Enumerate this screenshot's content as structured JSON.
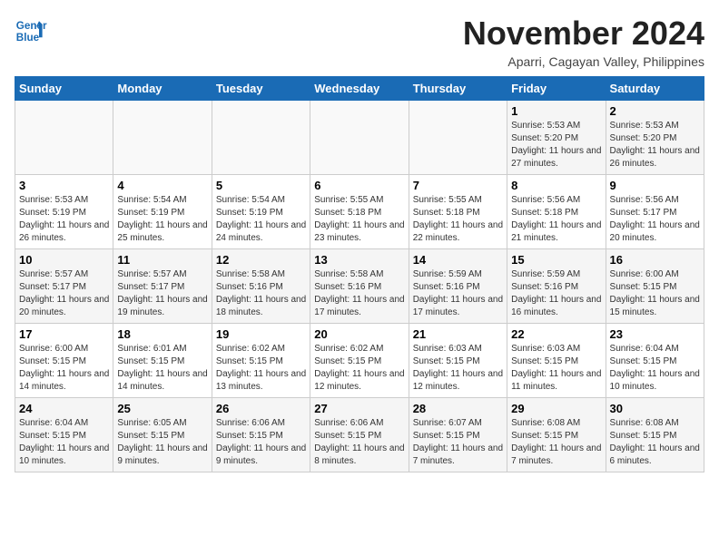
{
  "header": {
    "logo_line1": "General",
    "logo_line2": "Blue",
    "month": "November 2024",
    "location": "Aparri, Cagayan Valley, Philippines"
  },
  "weekdays": [
    "Sunday",
    "Monday",
    "Tuesday",
    "Wednesday",
    "Thursday",
    "Friday",
    "Saturday"
  ],
  "weeks": [
    [
      {
        "day": "",
        "info": ""
      },
      {
        "day": "",
        "info": ""
      },
      {
        "day": "",
        "info": ""
      },
      {
        "day": "",
        "info": ""
      },
      {
        "day": "",
        "info": ""
      },
      {
        "day": "1",
        "info": "Sunrise: 5:53 AM\nSunset: 5:20 PM\nDaylight: 11 hours and 27 minutes."
      },
      {
        "day": "2",
        "info": "Sunrise: 5:53 AM\nSunset: 5:20 PM\nDaylight: 11 hours and 26 minutes."
      }
    ],
    [
      {
        "day": "3",
        "info": "Sunrise: 5:53 AM\nSunset: 5:19 PM\nDaylight: 11 hours and 26 minutes."
      },
      {
        "day": "4",
        "info": "Sunrise: 5:54 AM\nSunset: 5:19 PM\nDaylight: 11 hours and 25 minutes."
      },
      {
        "day": "5",
        "info": "Sunrise: 5:54 AM\nSunset: 5:19 PM\nDaylight: 11 hours and 24 minutes."
      },
      {
        "day": "6",
        "info": "Sunrise: 5:55 AM\nSunset: 5:18 PM\nDaylight: 11 hours and 23 minutes."
      },
      {
        "day": "7",
        "info": "Sunrise: 5:55 AM\nSunset: 5:18 PM\nDaylight: 11 hours and 22 minutes."
      },
      {
        "day": "8",
        "info": "Sunrise: 5:56 AM\nSunset: 5:18 PM\nDaylight: 11 hours and 21 minutes."
      },
      {
        "day": "9",
        "info": "Sunrise: 5:56 AM\nSunset: 5:17 PM\nDaylight: 11 hours and 20 minutes."
      }
    ],
    [
      {
        "day": "10",
        "info": "Sunrise: 5:57 AM\nSunset: 5:17 PM\nDaylight: 11 hours and 20 minutes."
      },
      {
        "day": "11",
        "info": "Sunrise: 5:57 AM\nSunset: 5:17 PM\nDaylight: 11 hours and 19 minutes."
      },
      {
        "day": "12",
        "info": "Sunrise: 5:58 AM\nSunset: 5:16 PM\nDaylight: 11 hours and 18 minutes."
      },
      {
        "day": "13",
        "info": "Sunrise: 5:58 AM\nSunset: 5:16 PM\nDaylight: 11 hours and 17 minutes."
      },
      {
        "day": "14",
        "info": "Sunrise: 5:59 AM\nSunset: 5:16 PM\nDaylight: 11 hours and 17 minutes."
      },
      {
        "day": "15",
        "info": "Sunrise: 5:59 AM\nSunset: 5:16 PM\nDaylight: 11 hours and 16 minutes."
      },
      {
        "day": "16",
        "info": "Sunrise: 6:00 AM\nSunset: 5:15 PM\nDaylight: 11 hours and 15 minutes."
      }
    ],
    [
      {
        "day": "17",
        "info": "Sunrise: 6:00 AM\nSunset: 5:15 PM\nDaylight: 11 hours and 14 minutes."
      },
      {
        "day": "18",
        "info": "Sunrise: 6:01 AM\nSunset: 5:15 PM\nDaylight: 11 hours and 14 minutes."
      },
      {
        "day": "19",
        "info": "Sunrise: 6:02 AM\nSunset: 5:15 PM\nDaylight: 11 hours and 13 minutes."
      },
      {
        "day": "20",
        "info": "Sunrise: 6:02 AM\nSunset: 5:15 PM\nDaylight: 11 hours and 12 minutes."
      },
      {
        "day": "21",
        "info": "Sunrise: 6:03 AM\nSunset: 5:15 PM\nDaylight: 11 hours and 12 minutes."
      },
      {
        "day": "22",
        "info": "Sunrise: 6:03 AM\nSunset: 5:15 PM\nDaylight: 11 hours and 11 minutes."
      },
      {
        "day": "23",
        "info": "Sunrise: 6:04 AM\nSunset: 5:15 PM\nDaylight: 11 hours and 10 minutes."
      }
    ],
    [
      {
        "day": "24",
        "info": "Sunrise: 6:04 AM\nSunset: 5:15 PM\nDaylight: 11 hours and 10 minutes."
      },
      {
        "day": "25",
        "info": "Sunrise: 6:05 AM\nSunset: 5:15 PM\nDaylight: 11 hours and 9 minutes."
      },
      {
        "day": "26",
        "info": "Sunrise: 6:06 AM\nSunset: 5:15 PM\nDaylight: 11 hours and 9 minutes."
      },
      {
        "day": "27",
        "info": "Sunrise: 6:06 AM\nSunset: 5:15 PM\nDaylight: 11 hours and 8 minutes."
      },
      {
        "day": "28",
        "info": "Sunrise: 6:07 AM\nSunset: 5:15 PM\nDaylight: 11 hours and 7 minutes."
      },
      {
        "day": "29",
        "info": "Sunrise: 6:08 AM\nSunset: 5:15 PM\nDaylight: 11 hours and 7 minutes."
      },
      {
        "day": "30",
        "info": "Sunrise: 6:08 AM\nSunset: 5:15 PM\nDaylight: 11 hours and 6 minutes."
      }
    ]
  ]
}
